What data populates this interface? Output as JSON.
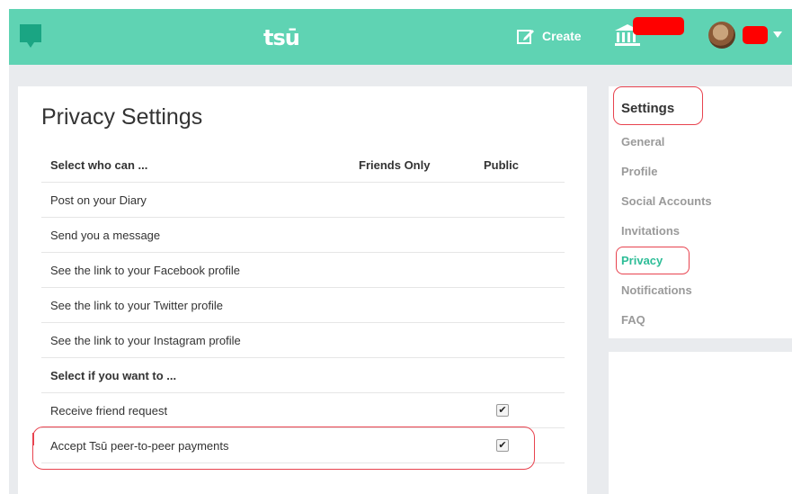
{
  "topbar": {
    "logo": "tsū",
    "create_label": "Create",
    "accent": "#5fd3b3"
  },
  "privacy": {
    "title": "Privacy Settings",
    "header": {
      "label": "Select who can ...",
      "friends_only": "Friends Only",
      "public": "Public"
    },
    "who_can_rows": [
      "Post on your Diary",
      "Send you a message",
      "See the link to your Facebook profile",
      "See the link to your Twitter profile",
      "See the link to your Instagram profile"
    ],
    "section2_label": "Select if you want to ...",
    "want_rows": [
      {
        "label": "Receive friend request",
        "checked": true
      },
      {
        "label": "Accept Tsū peer-to-peer payments",
        "checked": true
      }
    ]
  },
  "sidebar": {
    "heading": "Settings",
    "items": [
      {
        "label": "General",
        "active": false
      },
      {
        "label": "Profile",
        "active": false
      },
      {
        "label": "Social Accounts",
        "active": false
      },
      {
        "label": "Invitations",
        "active": false
      },
      {
        "label": "Privacy",
        "active": true
      },
      {
        "label": "Notifications",
        "active": false
      },
      {
        "label": "FAQ",
        "active": false
      }
    ],
    "active_color": "#2dbd97"
  },
  "icons": {
    "chat": "chat-bubble-icon",
    "create": "edit-icon",
    "bank": "bank-icon",
    "caret": "caret-down-icon"
  }
}
